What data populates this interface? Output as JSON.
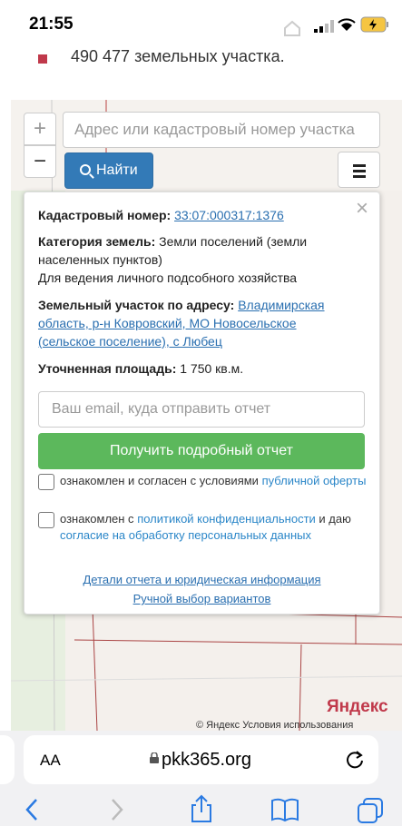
{
  "status": {
    "time": "21:55"
  },
  "page": {
    "bullet_text": "490 477 земельных участка."
  },
  "map": {
    "zoom_in": "+",
    "zoom_out": "−",
    "search_placeholder": "Адрес или кадастровый номер участка",
    "find_button": "Найти",
    "yandex_logo": "Яндекс",
    "yandex_footer": "© Яндекс  Условия использования"
  },
  "popup": {
    "close": "×",
    "cadastral_label": "Кадастровый номер:",
    "cadastral_value": "33:07:000317:1376",
    "category_label": "Категория земель:",
    "category_value": "Земли поселений (земли населенных пунктов)",
    "usage": "Для ведения личного подсобного хозяйства",
    "address_label": "Земельный участок по адресу:",
    "address_value": "Владимирская область, р-н Ковровский, МО Новосельское (сельское поселение), с Любец",
    "area_label": "Уточненная площадь:",
    "area_value": "1 750 кв.м.",
    "email_placeholder": "Ваш email, куда отправить отчет",
    "report_button": "Получить подробный отчет",
    "consent1_text": "ознакомлен и согласен с условиями ",
    "consent1_link": "публичной оферты",
    "consent2_text_a": "ознакомлен с ",
    "consent2_link1": "политикой конфиденциальности",
    "consent2_text_b": " и даю ",
    "consent2_link2": "согласие на обработку персональных данных",
    "details_link": "Детали отчета и юридическая информация",
    "manual_link": "Ручной выбор вариантов"
  },
  "browser": {
    "aa": "AA",
    "url": "pkk365.org"
  },
  "colors": {
    "find_button": "#337ab7",
    "report_button": "#5cb85c",
    "link": "#2a6fb0",
    "bullet": "#c0394b"
  }
}
